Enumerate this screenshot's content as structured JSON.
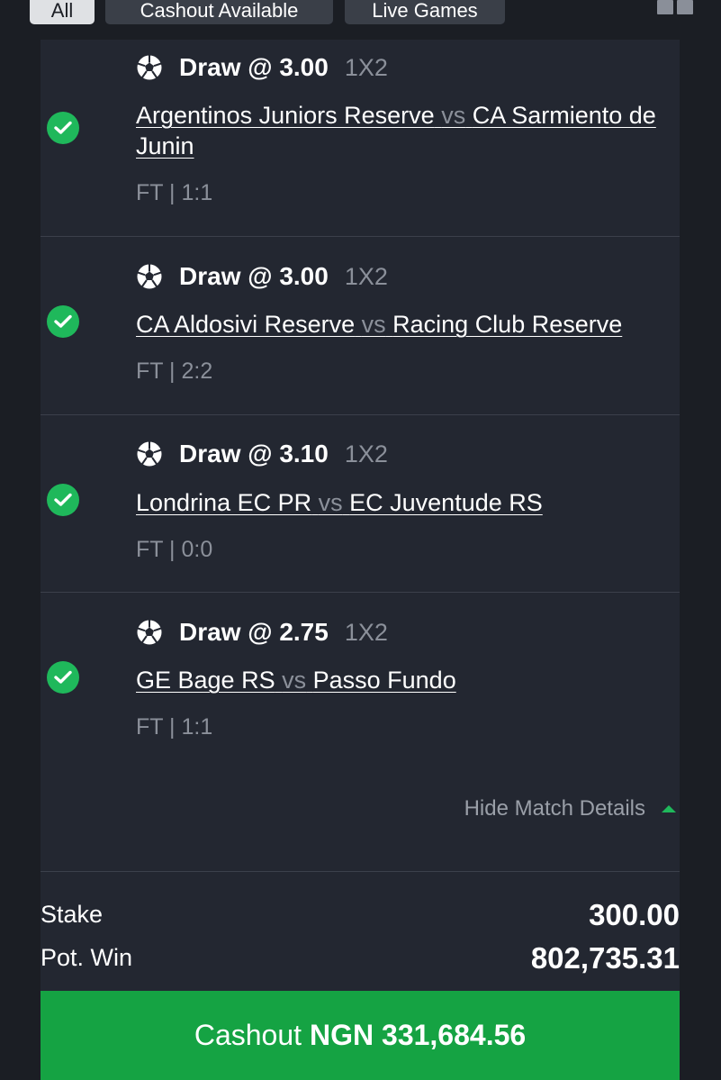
{
  "tabs": [
    {
      "label": "All"
    },
    {
      "label": "Cashout Available"
    },
    {
      "label": "Live Games"
    }
  ],
  "colors": {
    "background": "#1b1e24",
    "card": "#232731",
    "accent_green": "#15a343",
    "check_green": "#1fb85b",
    "muted_text": "#8b909a"
  },
  "icons": {
    "status": "check-circle-icon",
    "sport": "soccer-ball-icon",
    "collapse": "caret-up-icon",
    "layout": "layout-toggle-icon"
  },
  "matches": [
    {
      "pick": "Draw @ 3.00",
      "market": "1X2",
      "home": "Argentinos Juniors Reserve",
      "vs": "vs",
      "away": "CA Sarmiento de Junin",
      "result": "FT | 1:1",
      "status": "won"
    },
    {
      "pick": "Draw @ 3.00",
      "market": "1X2",
      "home": "CA Aldosivi Reserve",
      "vs": "vs",
      "away": "Racing Club Reserve",
      "result": "FT | 2:2",
      "status": "won"
    },
    {
      "pick": "Draw @ 3.10",
      "market": "1X2",
      "home": "Londrina EC PR",
      "vs": "vs",
      "away": "EC Juventude RS",
      "result": "FT | 0:0",
      "status": "won"
    },
    {
      "pick": "Draw @ 2.75",
      "market": "1X2",
      "home": "GE Bage RS",
      "vs": "vs",
      "away": "Passo Fundo",
      "result": "FT | 1:1",
      "status": "won"
    }
  ],
  "details_toggle": "Hide Match Details",
  "summary": {
    "stake_label": "Stake",
    "stake_value": "300.00",
    "potwin_label": "Pot. Win",
    "potwin_value": "802,735.31"
  },
  "cashout": {
    "label": "Cashout",
    "amount": "NGN 331,684.56"
  }
}
